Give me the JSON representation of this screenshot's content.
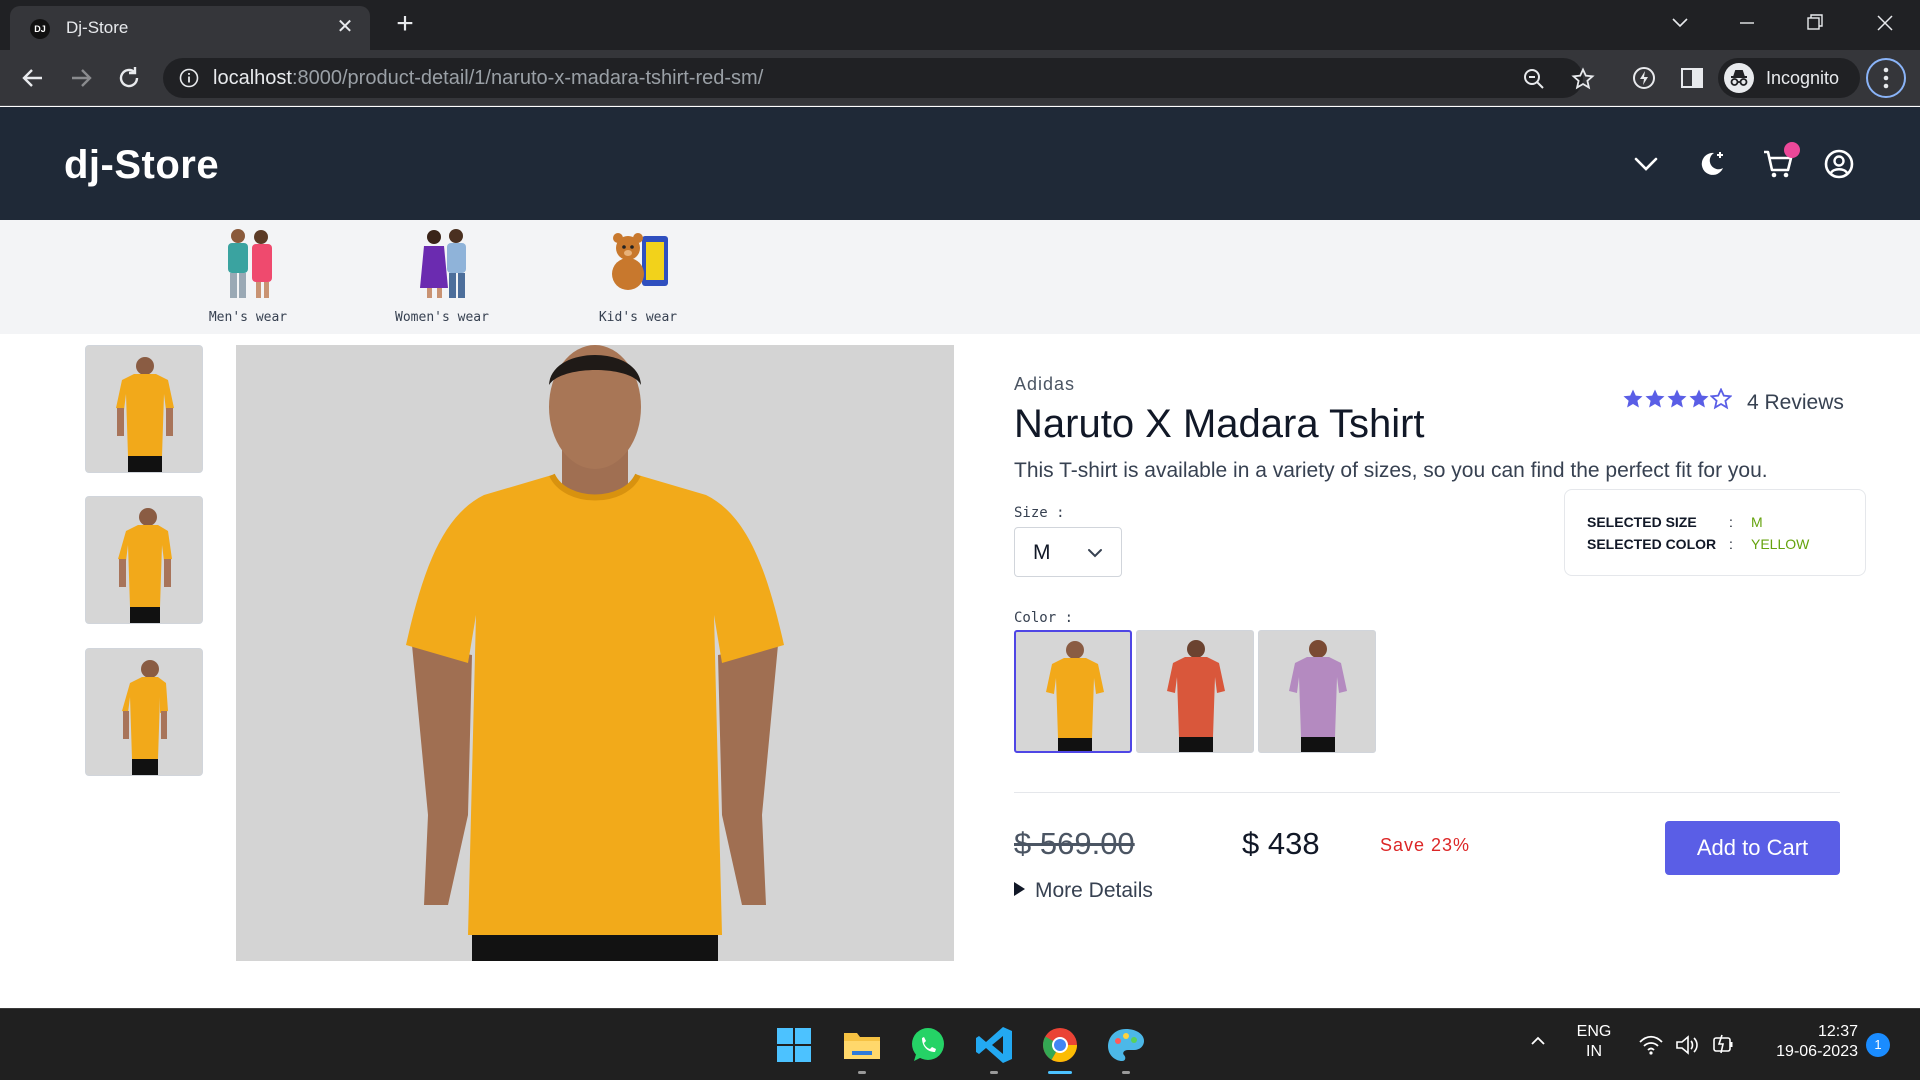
{
  "browser": {
    "tab_title": "Dj-Store",
    "favicon_text": "DJ",
    "url_host": "localhost",
    "url_rest": ":8000/product-detail/1/naruto-x-madara-tshirt-red-sm/",
    "profile_label": "Incognito"
  },
  "header": {
    "brand": "dj-Store"
  },
  "categories": [
    {
      "label": "Men's wear"
    },
    {
      "label": "Women's wear"
    },
    {
      "label": "Kid's wear"
    }
  ],
  "product": {
    "brand": "Adidas",
    "title": "Naruto X Madara Tshirt",
    "rating": 4,
    "rating_max": 5,
    "reviews_label": "4 Reviews",
    "description": "This T-shirt is available in a variety of sizes, so you can find the perfect fit for you.",
    "size_label": "Size :",
    "size_value": "M",
    "color_label": "Color :",
    "colors": [
      "#f2a91a",
      "#d9573b",
      "#b48ac0"
    ],
    "selected_size_label": "SELECTED SIZE",
    "selected_size_value": "M",
    "selected_color_label": "SELECTED COLOR",
    "selected_color_value": "YELLOW",
    "separator": ":",
    "old_price": "$ 569.00",
    "price": "$ 438",
    "save_label": "Save 23%",
    "add_to_cart": "Add to Cart",
    "more_details": "More Details"
  },
  "taskbar": {
    "lang_top": "ENG",
    "lang_bottom": "IN",
    "time": "12:37",
    "date": "19-06-2023",
    "notification_count": "1"
  },
  "colors": {
    "header_bg": "#1f2937",
    "accent": "#5a5ee6",
    "save_red": "#dc2626",
    "selected_value_green": "#65a30d"
  }
}
